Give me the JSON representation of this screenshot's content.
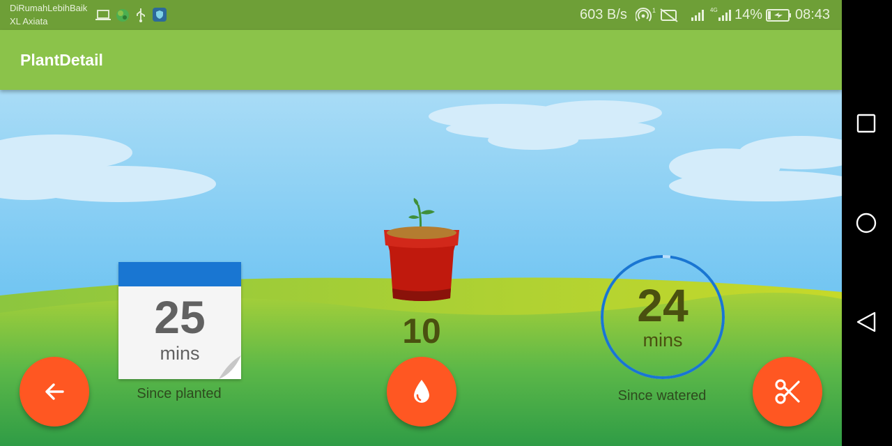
{
  "status_bar": {
    "carrier_line1": "DiRumahLebihBaik",
    "carrier_line2": "XL Axiata",
    "net_speed": "603 B/s",
    "sim_slot": "1",
    "lte": "4G",
    "battery_percent": "14%",
    "time": "08:43",
    "icons": [
      "laptop-icon",
      "globe-icon",
      "usb-icon",
      "shield-app-icon",
      "hotspot-icon",
      "no-sim-icon",
      "signal-icon",
      "lte-signal-icon",
      "battery-charging-icon"
    ]
  },
  "app_bar": {
    "title": "PlantDetail"
  },
  "planted": {
    "value": "25",
    "unit": "mins",
    "caption": "Since planted"
  },
  "plant": {
    "water_count": "10"
  },
  "watered": {
    "value": "24",
    "unit": "mins",
    "caption": "Since watered",
    "ring_progress": 0.98
  },
  "actions": {
    "back": {
      "icon": "arrow-back-icon"
    },
    "water": {
      "icon": "water-drop-icon"
    },
    "cut": {
      "icon": "scissors-icon"
    }
  },
  "nav_bar": {
    "buttons": [
      "recents-icon",
      "home-icon",
      "back-triangle-icon"
    ]
  },
  "colors": {
    "status_bar": "#6e9f37",
    "app_bar": "#8bc34a",
    "fab": "#ff5722",
    "calendar_header": "#1976d2",
    "ring": "#1976d2",
    "number_text": "#4a5010"
  }
}
